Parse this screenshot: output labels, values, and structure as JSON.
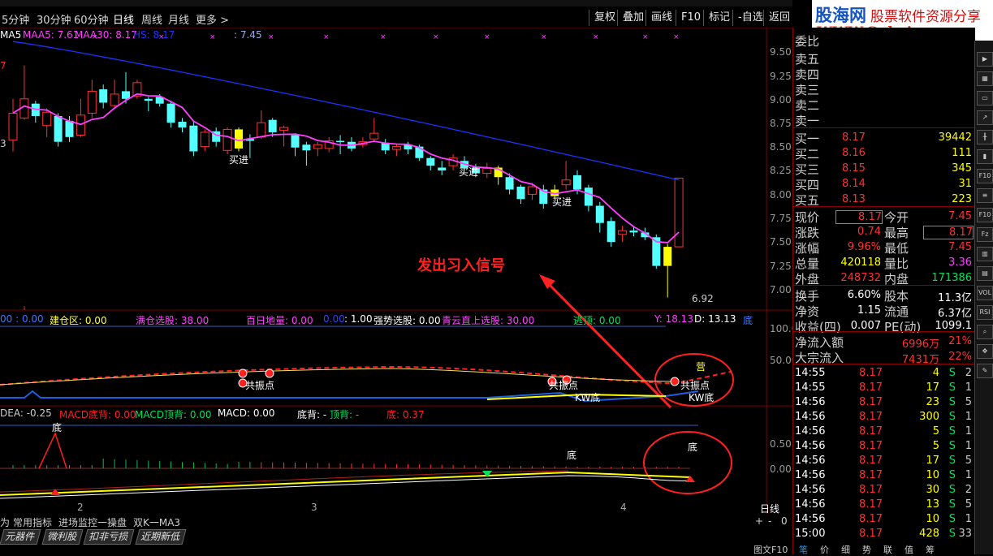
{
  "period_tabs": [
    "5分钟",
    "30分钟",
    "60分钟",
    "日线",
    "周线",
    "月线",
    "更多 >"
  ],
  "toolbar_buttons": [
    "复权",
    "叠加",
    "画线",
    "F10",
    "标记",
    "-自选",
    "返回"
  ],
  "logo": {
    "name": "股海网",
    "tagline": "股票软件资源分享",
    "url": "WWW.Guhai.com"
  },
  "ma_legend": {
    "ma5": "MA5",
    "maa5": "MAA5: 7.61",
    "maa30": "MAA30: 8.17",
    "hs": "HS: 8.17",
    "extra": ": 7.45"
  },
  "price_axis": [
    "9.50",
    "9.25",
    "9.00",
    "8.75",
    "8.50",
    "8.25",
    "8.00",
    "7.75",
    "7.50",
    "7.25",
    "7.00"
  ],
  "chart_labels": {
    "buy": "买进",
    "signal": "发出习入信号",
    "low_price": "6.92",
    "left_vals": [
      "7",
      "3"
    ]
  },
  "indicator1": {
    "left": "00 : 0.00",
    "jiancang": "建仓区: 0.00",
    "mancang": "满仓选股: 38.00",
    "bairi": "百日地量: 0.00",
    "blue": "0.00",
    "one": ": 1.00",
    "qiangshi": "强势选股: 0.00",
    "qingyun": "青云直上选股: 30.00",
    "taoding": "逃顶: 0.00",
    "y": "Y: 18.13",
    "d": "D: 13.13",
    "di": "底",
    "axis": [
      "100.0",
      "50.00"
    ],
    "labels": {
      "gongzhen": "共振点",
      "kw": "KW底",
      "di": "KW底",
      "ying": "营"
    }
  },
  "indicator2": {
    "dea": "DEA: -0.25",
    "macd_di": "MACD底背: 0.00",
    "macd_ding": "MACD顶背: 0.00",
    "macd": "MACD: 0.00",
    "dibei": "底背: -",
    "dingbei": "顶背: -",
    "di": "底: 0.37",
    "axis": [
      "0.50",
      "0.00"
    ],
    "label_di": "底"
  },
  "x_axis_marks": [
    "2",
    "3",
    "4"
  ],
  "period_label": "日线",
  "bottom_tabs": [
    "为",
    "常用指标",
    "进场监控一操盘",
    "双K一MA3"
  ],
  "bottom_nav": [
    "元器件",
    "微利股",
    "扣非亏损",
    "近期新低"
  ],
  "bottom_ctrl": [
    "+",
    "-",
    "0"
  ],
  "order_book": {
    "wei": "委比",
    "sells": [
      {
        "label": "卖五"
      },
      {
        "label": "卖四"
      },
      {
        "label": "卖三"
      },
      {
        "label": "卖二"
      },
      {
        "label": "卖一"
      }
    ],
    "buys": [
      {
        "label": "买一",
        "price": "8.17",
        "vol": "39442"
      },
      {
        "label": "买二",
        "price": "8.16",
        "vol": "111"
      },
      {
        "label": "买三",
        "price": "8.15",
        "vol": "345"
      },
      {
        "label": "买四",
        "price": "8.14",
        "vol": "31"
      },
      {
        "label": "买五",
        "price": "8.13",
        "vol": "223"
      }
    ]
  },
  "quote": [
    {
      "l1": "现价",
      "v1": "8.17",
      "l2": "今开",
      "v2": "7.45"
    },
    {
      "l1": "涨跌",
      "v1": "0.74",
      "l2": "最高",
      "v2": "8.17"
    },
    {
      "l1": "涨幅",
      "v1": "9.96%",
      "l2": "最低",
      "v2": "7.45"
    },
    {
      "l1": "总量",
      "v1": "420118",
      "l2": "量比",
      "v2": "3.36"
    },
    {
      "l1": "外盘",
      "v1": "248732",
      "l2": "内盘",
      "v2": "171386"
    }
  ],
  "fundamentals": [
    {
      "l1": "换手",
      "v1": "6.60%",
      "l2": "股本",
      "v2": "11.3亿"
    },
    {
      "l1": "净资",
      "v1": "1.15",
      "l2": "流通",
      "v2": "6.37亿"
    },
    {
      "l1": "收益(四)",
      "v1": "0.007",
      "l2": "PE(动)",
      "v2": "1099.1"
    }
  ],
  "flows": [
    {
      "label": "净流入额",
      "amount": "6996万",
      "pct": "21%"
    },
    {
      "label": "大宗流入",
      "amount": "7431万",
      "pct": "22%"
    }
  ],
  "ticks": [
    {
      "t": "14:55",
      "p": "8.17",
      "v": "4",
      "s": "S",
      "n": "2"
    },
    {
      "t": "14:55",
      "p": "8.17",
      "v": "17",
      "s": "S",
      "n": "1"
    },
    {
      "t": "14:56",
      "p": "8.17",
      "v": "23",
      "s": "S",
      "n": "5"
    },
    {
      "t": "14:56",
      "p": "8.17",
      "v": "300",
      "s": "S",
      "n": "1"
    },
    {
      "t": "14:56",
      "p": "8.17",
      "v": "5",
      "s": "S",
      "n": "1"
    },
    {
      "t": "14:56",
      "p": "8.17",
      "v": "5",
      "s": "S",
      "n": "1"
    },
    {
      "t": "14:56",
      "p": "8.17",
      "v": "17",
      "s": "S",
      "n": "5"
    },
    {
      "t": "14:56",
      "p": "8.17",
      "v": "10",
      "s": "S",
      "n": "1"
    },
    {
      "t": "14:56",
      "p": "8.17",
      "v": "30",
      "s": "S",
      "n": "2"
    },
    {
      "t": "14:56",
      "p": "8.17",
      "v": "13",
      "s": "S",
      "n": "5"
    },
    {
      "t": "14:56",
      "p": "8.17",
      "v": "10",
      "s": "S",
      "n": "1"
    },
    {
      "t": "15:00",
      "p": "8.17",
      "v": "428",
      "s": "S",
      "n": "33"
    }
  ],
  "footer": [
    "图文F10",
    "笔",
    "价",
    "细",
    "势",
    "联",
    "值",
    "筹"
  ],
  "colors": {
    "up": "#ff3333",
    "down": "#54ffff",
    "yellow": "#ffff00",
    "magenta": "#ff40ff",
    "blue": "#2030ff",
    "green": "#00e060",
    "red": "#ff2020"
  }
}
